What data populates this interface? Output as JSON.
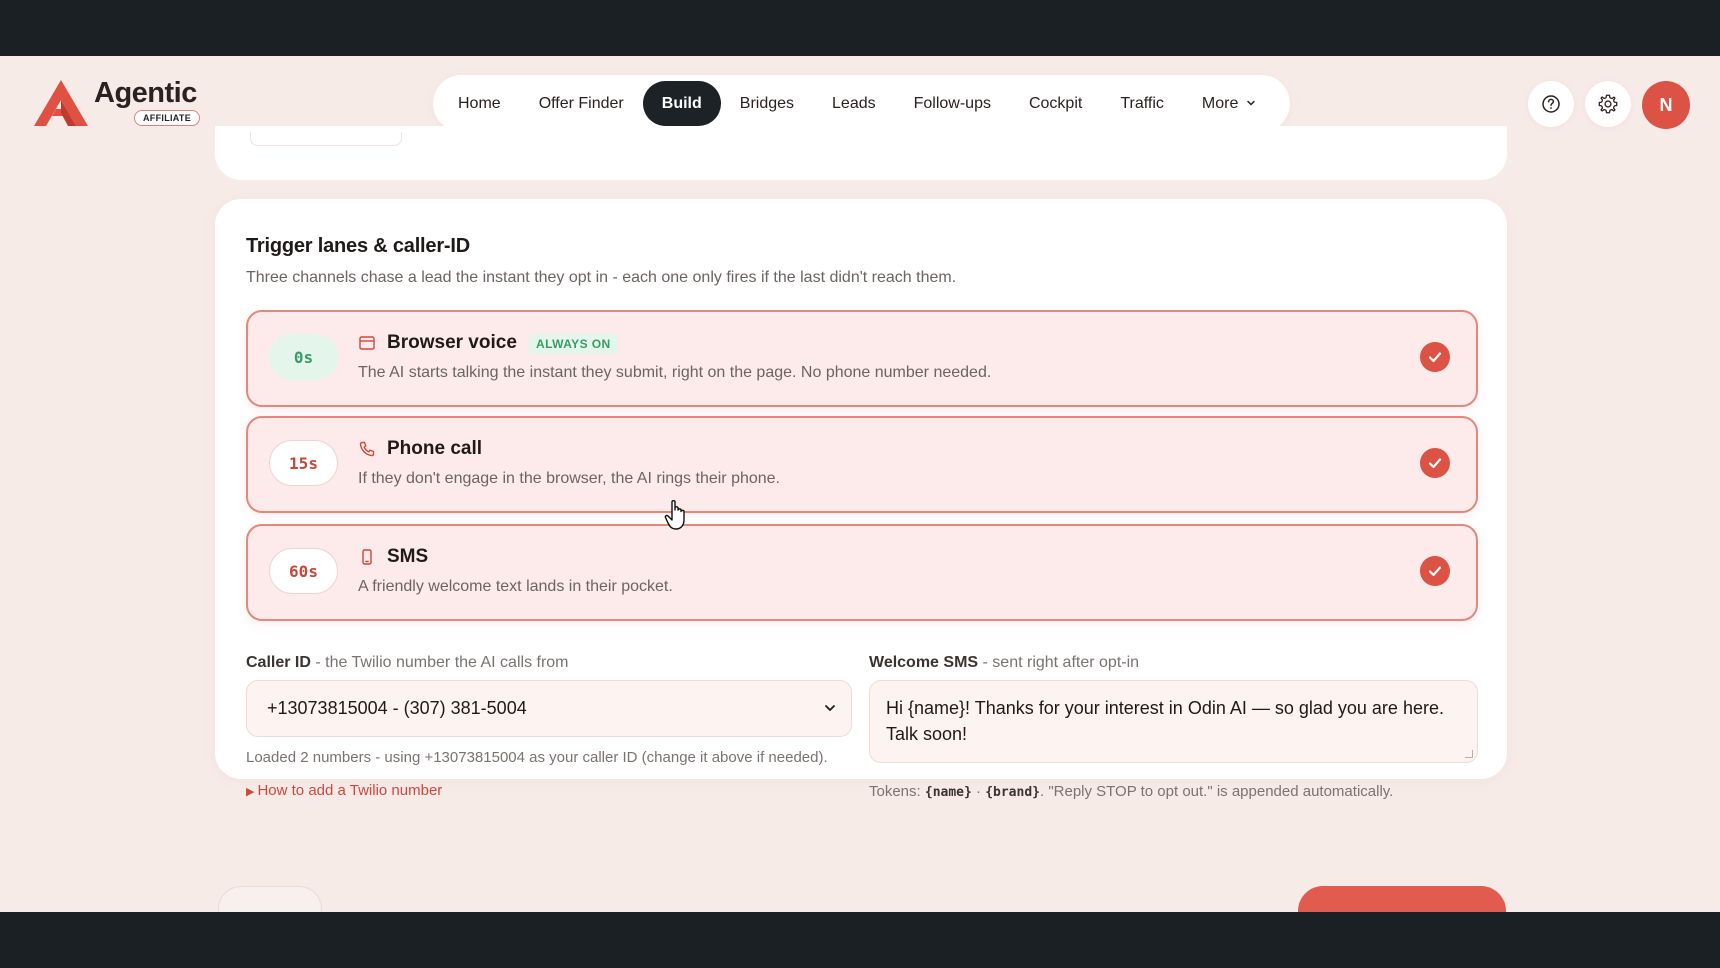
{
  "header": {
    "logo": {
      "name": "Agentic",
      "badge": "AFFILIATE"
    },
    "nav": [
      {
        "label": "Home",
        "active": false
      },
      {
        "label": "Offer Finder",
        "active": false
      },
      {
        "label": "Build",
        "active": true
      },
      {
        "label": "Bridges",
        "active": false
      },
      {
        "label": "Leads",
        "active": false
      },
      {
        "label": "Follow-ups",
        "active": false
      },
      {
        "label": "Cockpit",
        "active": false
      },
      {
        "label": "Traffic",
        "active": false
      },
      {
        "label": "More",
        "active": false,
        "icon": "chevron-down-icon"
      }
    ],
    "help_icon": "question-circle-icon",
    "settings_icon": "gear-icon",
    "avatar_initial": "N"
  },
  "card": {
    "title": "Trigger lanes & caller-ID",
    "subtitle": "Three channels chase a lead the instant they opt in - each one only fires if the last didn't reach them.",
    "lanes": [
      {
        "delay": "0s",
        "icon": "browser-window-icon",
        "name": "Browser voice",
        "tag": "ALWAYS ON",
        "description": "The AI starts talking the instant they submit, right on the page. No phone number needed.",
        "checked": true
      },
      {
        "delay": "15s",
        "icon": "phone-icon",
        "name": "Phone call",
        "tag": "",
        "description": "If they don't engage in the browser, the AI rings their phone.",
        "checked": true
      },
      {
        "delay": "60s",
        "icon": "mobile-icon",
        "name": "SMS",
        "tag": "",
        "description": "A friendly welcome text lands in their pocket.",
        "checked": true
      }
    ],
    "caller_id": {
      "label": "Caller ID",
      "label_suffix": " - the Twilio number the AI calls from",
      "value": "+13073815004 - (307) 381-5004",
      "hint": "Loaded 2 numbers - using +13073815004 as your caller ID (change it above if needed).",
      "help_link": "How to add a Twilio number"
    },
    "welcome_sms": {
      "label": "Welcome SMS",
      "label_suffix": " - sent right after opt-in",
      "value": "Hi {name}! Thanks for your interest in Odin AI — so glad you are here. Talk soon!",
      "tokens_prefix": "Tokens: ",
      "token_name": "{name}",
      "token_sep": " · ",
      "token_brand": "{brand}",
      "tokens_suffix": ". \"Reply STOP to opt out.\" is appended automatically."
    }
  },
  "colors": {
    "accent": "#dc5245",
    "lane_border": "#e5877e",
    "lane_bg": "#fcebea",
    "success": "#3a9b66",
    "nav_active": "#1c2226",
    "page_bg": "#f7ebe8"
  }
}
